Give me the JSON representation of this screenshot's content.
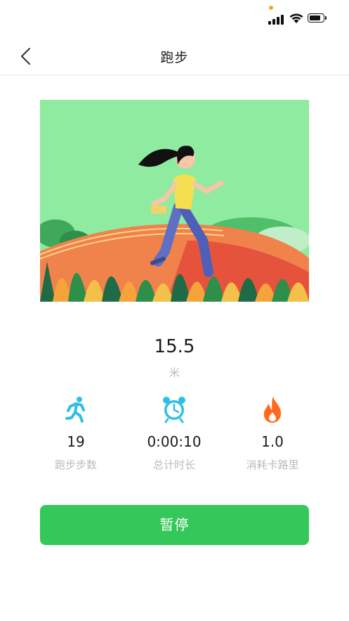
{
  "nav": {
    "title": "跑步"
  },
  "distance": {
    "value": "15.5",
    "unit": "米"
  },
  "stats": [
    {
      "icon": "running-person-icon",
      "value": "19",
      "label": "跑步步数"
    },
    {
      "icon": "alarm-clock-icon",
      "value": "0:00:10",
      "label": "总计时长"
    },
    {
      "icon": "flame-icon",
      "value": "1.0",
      "label": "消耗卡路里"
    }
  ],
  "actions": {
    "pause_label": "暂停"
  },
  "colors": {
    "accent": "#34c759",
    "illustration_bg": "#8eeba0",
    "stat_icon_blue": "#2bc0e4",
    "stat_icon_orange": "#ff6a1a"
  }
}
